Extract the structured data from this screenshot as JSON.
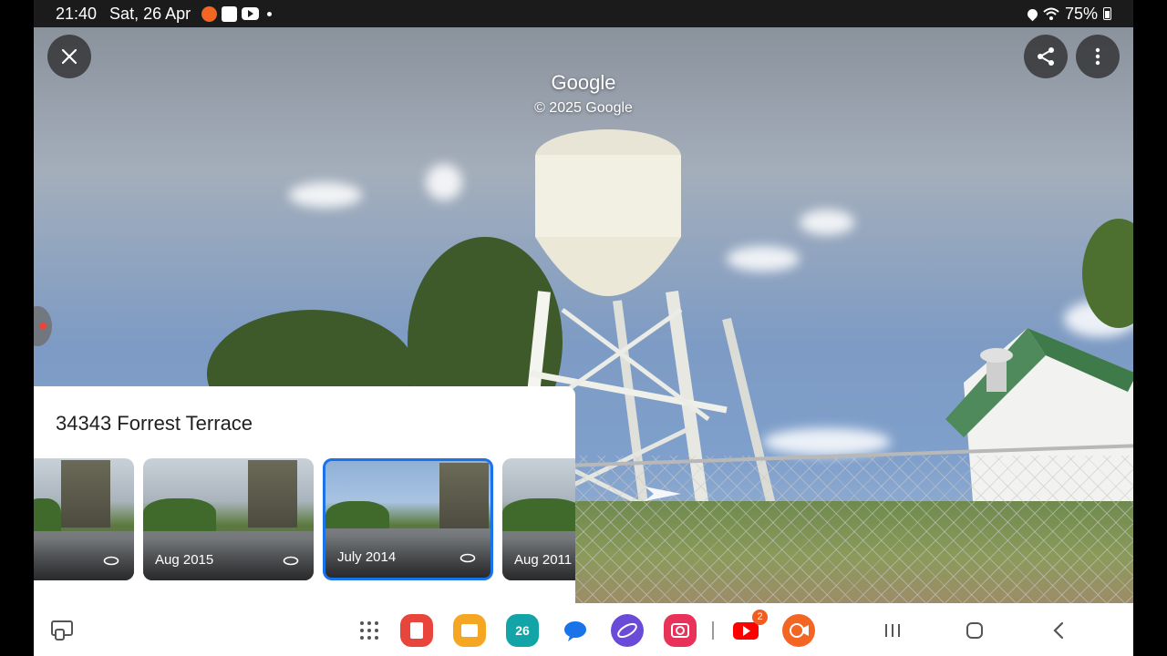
{
  "status_bar": {
    "time": "21:40",
    "date": "Sat, 26 Apr",
    "notification_icons": [
      "screen-recorder-icon",
      "gallery-icon",
      "youtube-icon"
    ],
    "battery": "75%"
  },
  "viewer": {
    "brand": "Google",
    "copyright": "© 2025 Google",
    "close_icon": "close-icon",
    "share_icon": "share-icon",
    "menu_icon": "more-vert-icon"
  },
  "sheet": {
    "title": "34343 Forrest Terrace",
    "thumbnails": [
      {
        "label": "",
        "selected": false
      },
      {
        "label": "Aug 2015",
        "selected": false
      },
      {
        "label": "July 2014",
        "selected": true
      },
      {
        "label": "Aug 2011",
        "selected": false
      }
    ]
  },
  "taskbar": {
    "apps": [
      "apps-grid-icon",
      "notes-app-icon",
      "files-app-icon",
      "calendar-app-icon",
      "messages-app-icon",
      "internet-app-icon",
      "camera-app-icon",
      "youtube-app-icon",
      "screen-recorder-app-icon"
    ],
    "calendar_day": "26",
    "youtube_badge": "2"
  },
  "colors": {
    "accent": "#1a73e8",
    "notes": "#e8453c",
    "files": "#f5a623",
    "calendar": "#12a4a6",
    "messages": "#1a73e8",
    "internet": "#6a4bd8",
    "camera": "#e8325a",
    "youtube": "#ff0000",
    "recorder": "#f26522"
  }
}
